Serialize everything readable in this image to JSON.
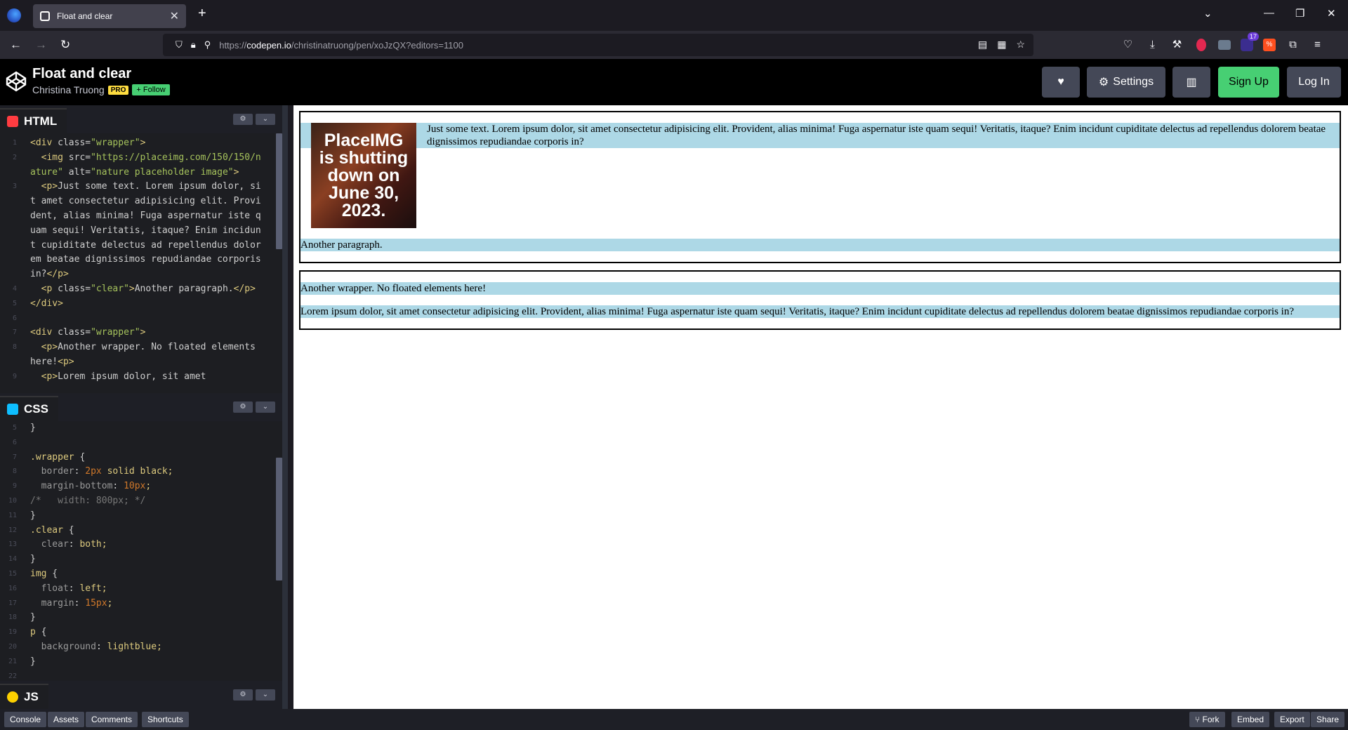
{
  "browser": {
    "tab_title": "Float and clear",
    "url_prefix": "https://",
    "url_host": "codepen.io",
    "url_path": "/christinatruong/pen/xoJzQX?editors=1100",
    "notification_count": "17"
  },
  "header": {
    "title": "Float and clear",
    "author": "Christina Truong",
    "pro_badge": "PRO",
    "follow_label": "+ Follow",
    "settings_label": "Settings",
    "signup_label": "Sign Up",
    "login_label": "Log In"
  },
  "editors": {
    "html_label": "HTML",
    "css_label": "CSS",
    "js_label": "JS"
  },
  "html_code": [
    {
      "n": "1",
      "t": "<div class=\"wrapper\">"
    },
    {
      "n": "2",
      "t": "  <img src=\"https://placeimg.com/150/150/nature\" alt=\"nature placeholder image\">"
    },
    {
      "n": "3",
      "t": "  <p>Just some text. Lorem ipsum dolor, sit amet consectetur adipisicing elit. Provident, alias minima! Fuga aspernatur iste quam sequi! Veritatis, itaque? Enim incidunt cupiditate delectus ad repellendus dolorem beatae dignissimos repudiandae corporis in?</p>"
    },
    {
      "n": "4",
      "t": "  <p class=\"clear\">Another paragraph.</p>"
    },
    {
      "n": "5",
      "t": "</div>"
    },
    {
      "n": "6",
      "t": ""
    },
    {
      "n": "7",
      "t": "<div class=\"wrapper\">"
    },
    {
      "n": "8",
      "t": "  <p>Another wrapper. No floated elements here!<p>"
    },
    {
      "n": "9",
      "t": "  <p>Lorem ipsum dolor, sit amet"
    }
  ],
  "css_code": [
    {
      "n": "5",
      "t": "}"
    },
    {
      "n": "6",
      "t": ""
    },
    {
      "n": "7",
      "t": ".wrapper {"
    },
    {
      "n": "8",
      "t": "  border: 2px solid black;"
    },
    {
      "n": "9",
      "t": "  margin-bottom: 10px;"
    },
    {
      "n": "10",
      "t": "/*   width: 800px; */"
    },
    {
      "n": "11",
      "t": "}"
    },
    {
      "n": "12",
      "t": ".clear {"
    },
    {
      "n": "13",
      "t": "  clear: both;"
    },
    {
      "n": "14",
      "t": "}"
    },
    {
      "n": "15",
      "t": "img {"
    },
    {
      "n": "16",
      "t": "  float: left;"
    },
    {
      "n": "17",
      "t": "  margin: 15px;"
    },
    {
      "n": "18",
      "t": "}"
    },
    {
      "n": "19",
      "t": "p {"
    },
    {
      "n": "20",
      "t": "  background: lightblue;"
    },
    {
      "n": "21",
      "t": "}"
    },
    {
      "n": "22",
      "t": ""
    }
  ],
  "preview": {
    "placeholder_text": "PlaceIMG is shutting down on June 30, 2023.",
    "p1": "Just some text. Lorem ipsum dolor, sit amet consectetur adipisicing elit. Provident, alias minima! Fuga aspernatur iste quam sequi! Veritatis, itaque? Enim incidunt cupiditate delectus ad repellendus dolorem beatae dignissimos repudiandae corporis in?",
    "p2": "Another paragraph.",
    "p3": "Another wrapper. No floated elements here!",
    "p4": "Lorem ipsum dolor, sit amet consectetur adipisicing elit. Provident, alias minima! Fuga aspernatur iste quam sequi! Veritatis, itaque? Enim incidunt cupiditate delectus ad repellendus dolorem beatae dignissimos repudiandae corporis in?"
  },
  "footer": {
    "console": "Console",
    "assets": "Assets",
    "comments": "Comments",
    "shortcuts": "Shortcuts",
    "fork": "Fork",
    "embed": "Embed",
    "export": "Export",
    "share": "Share"
  },
  "colors": {
    "brand_green": "#47cf73",
    "pro_yellow": "#ffdd40",
    "html_icon": "#ff3c41",
    "css_icon": "#0ebeff",
    "js_icon": "#fcd000",
    "paragraph_bg": "lightblue"
  }
}
